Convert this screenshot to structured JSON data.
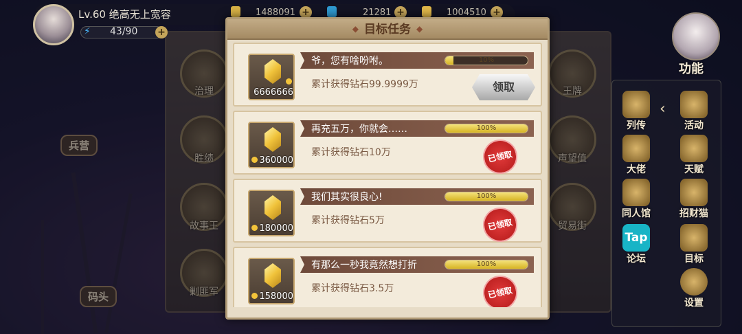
{
  "player": {
    "level_title": "Lv.60  绝高无上宽容",
    "energy": "43/90"
  },
  "resources": [
    {
      "name": "gold",
      "value": "1488091",
      "color": "#d8b246"
    },
    {
      "name": "gems",
      "value": "21281",
      "color": "#2f9ad1"
    },
    {
      "name": "coins",
      "value": "1004510",
      "color": "#e1b84a"
    }
  ],
  "modal": {
    "title": "目标任务"
  },
  "tasks": [
    {
      "name": "爷，您有啥吩咐。",
      "progress_text": "10%",
      "progress": 0.1,
      "desc": "累计获得钻石99.9999万",
      "reward": "6666666",
      "status": "claimable",
      "action_label": "领取"
    },
    {
      "name": "再充五万，你就会……",
      "progress_text": "100%",
      "progress": 1.0,
      "desc": "累计获得钻石10万",
      "reward": "360000",
      "status": "claimed",
      "action_label": "已领取"
    },
    {
      "name": "我们其实很良心!",
      "progress_text": "100%",
      "progress": 1.0,
      "desc": "累计获得钻石5万",
      "reward": "180000",
      "status": "claimed",
      "action_label": "已领取"
    },
    {
      "name": "有那么一秒我竟然想打折",
      "progress_text": "100%",
      "progress": 1.0,
      "desc": "累计获得钻石3.5万",
      "reward": "158000",
      "status": "claimed",
      "action_label": "已领取"
    }
  ],
  "background": {
    "left_buildings": [
      "治理",
      "胜绩",
      "故事王",
      "剿匪军"
    ],
    "right_buildings": [
      "王牌",
      "声望值",
      "贸易街"
    ],
    "signs": [
      "兵营",
      "码头"
    ]
  },
  "side_menu": {
    "func_label": "功能",
    "items": [
      "列传",
      "活动",
      "大佬",
      "天赋",
      "同人馆",
      "招财猫",
      "论坛",
      "目标",
      "设置"
    ],
    "tap_text": "Tap"
  }
}
